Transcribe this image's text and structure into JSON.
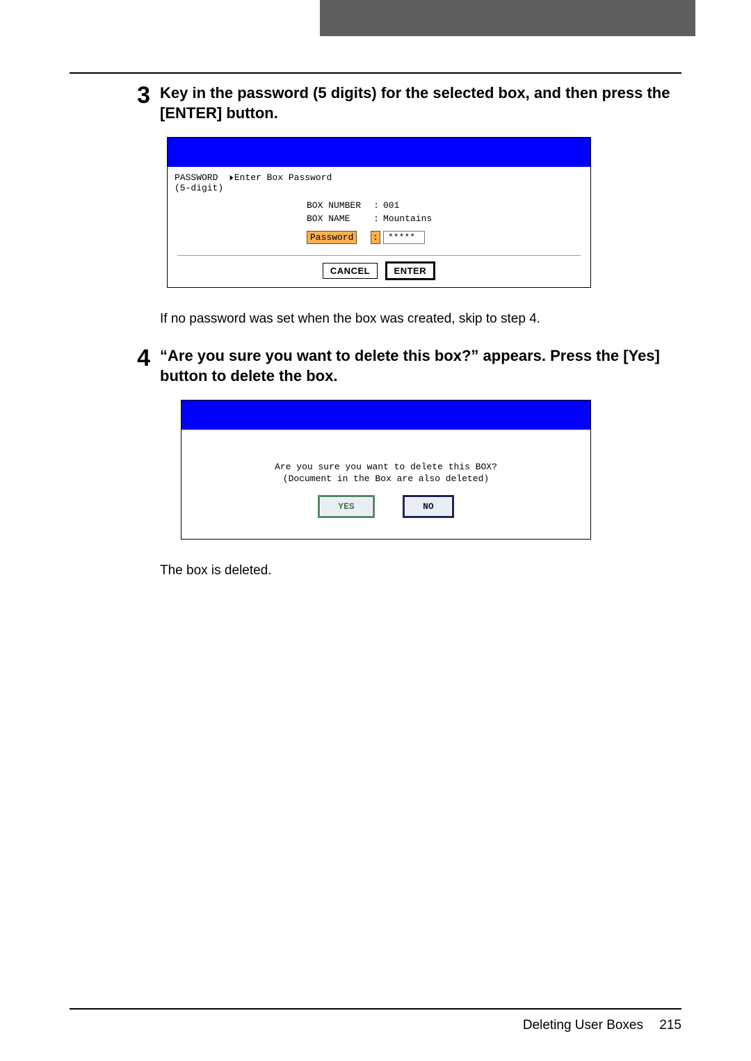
{
  "step3": {
    "number": "3",
    "heading": "Key in the password (5 digits) for the selected box, and then press the [ENTER] button.",
    "screen": {
      "header_label": "PASSWORD",
      "header_prompt": "Enter Box Password",
      "header_sub": "(5-digit)",
      "box_number_label": "BOX NUMBER",
      "box_number_value": "001",
      "box_name_label": "BOX NAME",
      "box_name_value": "Mountains",
      "password_label": "Password",
      "password_value": "*****",
      "cancel_label": "CANCEL",
      "enter_label": "ENTER"
    },
    "after_text": "If no password was set when the box was created, skip to step 4."
  },
  "step4": {
    "number": "4",
    "heading": "“Are you sure you want to delete this box?” appears. Press the [Yes] button to delete the box.",
    "screen": {
      "line1": "Are you sure you want to delete this BOX?",
      "line2": "(Document in the Box are also deleted)",
      "yes_label": "YES",
      "no_label": "NO"
    },
    "after_text": "The box is deleted."
  },
  "footer": {
    "section": "Deleting User Boxes",
    "page": "215"
  }
}
